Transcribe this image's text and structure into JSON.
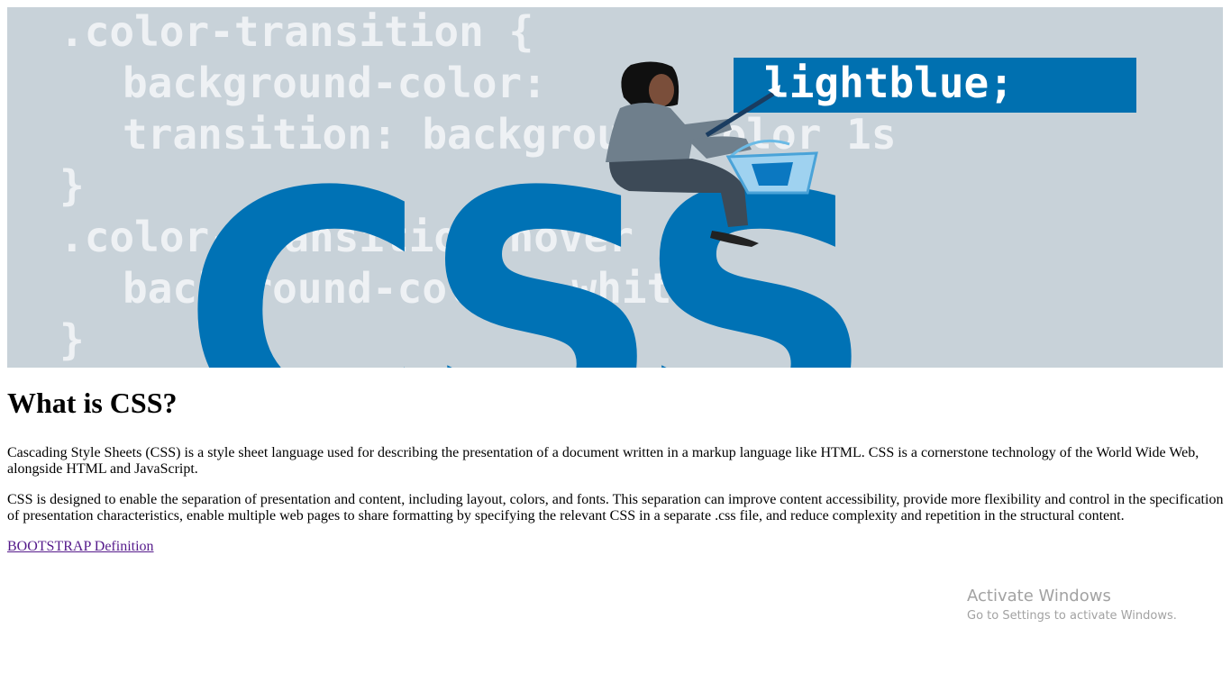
{
  "hero": {
    "code_lines": [
      ".color-transition {",
      "background-color:",
      "transition: background-color 1s",
      "}",
      ".color-transition:hover {",
      "background-color: white;",
      "}"
    ],
    "highlight_word": "lightblue;",
    "big_text": "CSS",
    "colors": {
      "background": "#c8d2d9",
      "code_text": "#eef1f4",
      "brand_blue": "#0072b5",
      "highlight_box": "#0070b0"
    }
  },
  "article": {
    "heading": "What is CSS?",
    "paragraph1": "Cascading Style Sheets (CSS) is a style sheet language used for describing the presentation of a document written in a markup language like HTML. CSS is a cornerstone technology of the World Wide Web, alongside HTML and JavaScript.",
    "paragraph2": "CSS is designed to enable the separation of presentation and content, including layout, colors, and fonts. This separation can improve content accessibility, provide more flexibility and control in the specification of presentation characteristics, enable multiple web pages to share formatting by specifying the relevant CSS in a separate .css file, and reduce complexity and repetition in the structural content.",
    "link_text": "BOOTSTRAP Definition",
    "link_color": "#551a8b"
  },
  "watermark": {
    "title": "Activate Windows",
    "subtitle": "Go to Settings to activate Windows."
  }
}
